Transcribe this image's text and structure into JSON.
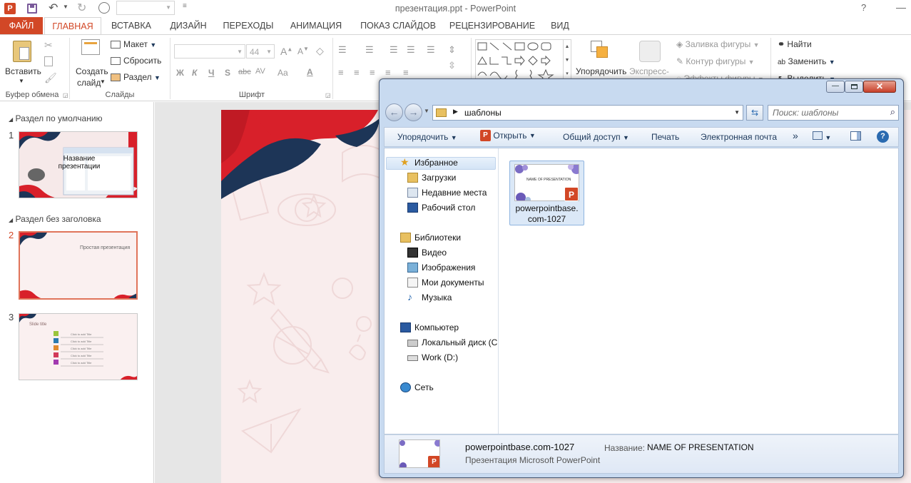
{
  "titlebar": {
    "title": "презентация.ppt - PowerPoint",
    "help": "?"
  },
  "tabs": [
    "ФАЙЛ",
    "ГЛАВНАЯ",
    "ВСТАВКА",
    "ДИЗАЙН",
    "ПЕРЕХОДЫ",
    "АНИМАЦИЯ",
    "ПОКАЗ СЛАЙДОВ",
    "РЕЦЕНЗИРОВАНИЕ",
    "ВИД"
  ],
  "ribbon": {
    "paste": "Вставить",
    "clipboard_group": "Буфер обмена",
    "new_slide_line1": "Создать",
    "new_slide_line2": "слайд",
    "layout": "Макет",
    "reset": "Сбросить",
    "section": "Раздел",
    "slides_group": "Слайды",
    "font_size": "44",
    "bold": "Ж",
    "italic": "К",
    "underline": "Ч",
    "shadow": "S",
    "strike": "abc",
    "spacing": "AV",
    "case": "Aa",
    "font_group": "Шрифт",
    "arrange": "Упорядочить",
    "quick_styles": "Экспресс-",
    "shape_fill": "Заливка фигуры",
    "shape_outline": "Контур фигуры",
    "shape_effects": "Эффекты фигуры",
    "find": "Найти",
    "replace": "Заменить",
    "select": "Выделить"
  },
  "thumbnails": {
    "section1": "Раздел по умолчанию",
    "section2": "Раздел без заголовка",
    "slides": [
      {
        "num": "1",
        "caption": "Название презентации"
      },
      {
        "num": "2",
        "caption": "Простая презентация"
      },
      {
        "num": "3",
        "caption": "Slide title",
        "items": [
          "Click to add Title",
          "Click to add Title",
          "Click to add Title",
          "Click to add Title",
          "Click to add Title"
        ]
      }
    ]
  },
  "explorer": {
    "path_folder": "шаблоны",
    "search_placeholder": "Поиск: шаблоны",
    "toolbar": {
      "organize": "Упорядочить",
      "open": "Открыть",
      "share": "Общий доступ",
      "print": "Печать",
      "email": "Электронная почта",
      "more": "»"
    },
    "nav": {
      "favorites": "Избранное",
      "downloads": "Загрузки",
      "recent": "Недавние места",
      "desktop": "Рабочий стол",
      "libraries": "Библиотеки",
      "video": "Видео",
      "images": "Изображения",
      "documents": "Мои документы",
      "music": "Музыка",
      "computer": "Компьютер",
      "local_disk": "Локальный диск (C",
      "work_disk": "Work (D:)",
      "network": "Сеть"
    },
    "file": {
      "name_line1": "powerpointbase.",
      "name_line2": "com-1027",
      "thumb_title": "NAME OF PRESENTATION"
    },
    "status": {
      "filename": "powerpointbase.com-1027",
      "filetype": "Презентация Microsoft PowerPoint",
      "title_label": "Название:",
      "title_value": "NAME OF PRESENTATION"
    }
  },
  "colors": {
    "accent": "#d24726",
    "navy": "#1d3557",
    "red": "#d8202a"
  }
}
